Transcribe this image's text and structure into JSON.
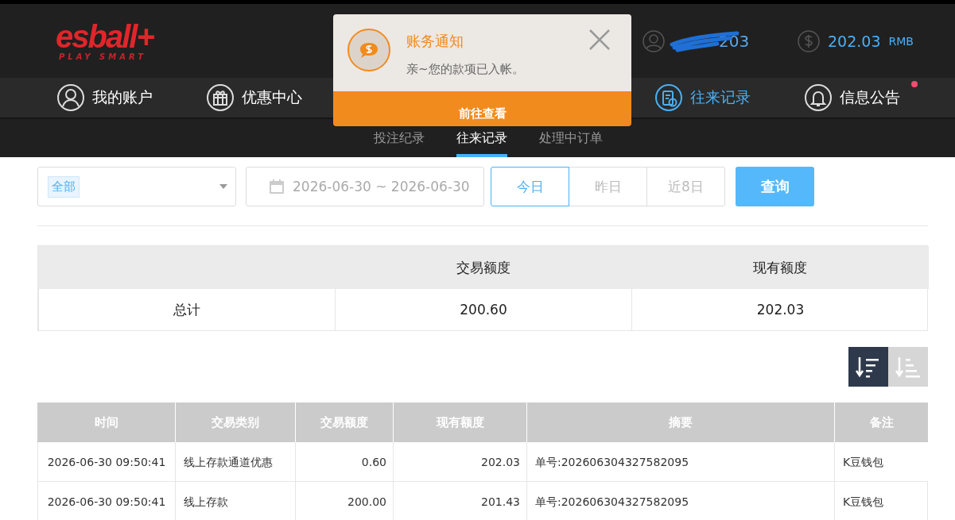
{
  "header": {
    "logo": {
      "name": "esball+",
      "tagline": "PLAY SMART"
    },
    "username": "203",
    "balance": "202.03",
    "currency": "RMB"
  },
  "nav": [
    {
      "label": "我的账户",
      "selected": false,
      "badge": false
    },
    {
      "label": "优惠中心",
      "selected": false,
      "badge": false
    },
    {
      "label": "往来记录",
      "selected": true,
      "badge": false
    },
    {
      "label": "信息公告",
      "selected": false,
      "badge": true
    }
  ],
  "subtabs": [
    {
      "label": "投注纪录",
      "selected": false
    },
    {
      "label": "往来记录",
      "selected": true
    },
    {
      "label": "处理中订单",
      "selected": false
    }
  ],
  "notification": {
    "title": "账务通知",
    "message": "亲~您的款项已入帐。",
    "action": "前往查看"
  },
  "filters": {
    "type_tag": "全部",
    "date_range": "2026-06-30 ~ 2026-06-30",
    "ranges": [
      {
        "label": "今日",
        "selected": true
      },
      {
        "label": "昨日",
        "selected": false
      },
      {
        "label": "近8日",
        "selected": false
      }
    ],
    "query": "查询"
  },
  "summary": {
    "columns": [
      "交易额度",
      "现有额度"
    ],
    "label": "总计",
    "values": [
      "200.60",
      "202.03"
    ]
  },
  "sort": [
    {
      "kind": "descending",
      "selected": true
    },
    {
      "kind": "ascending",
      "selected": false
    }
  ],
  "table": {
    "columns": [
      "时间",
      "交易类别",
      "交易额度",
      "现有额度",
      "摘要",
      "备注"
    ],
    "rows": [
      [
        "2026-06-30 09:50:41",
        "线上存款通道优惠",
        "0.60",
        "202.03",
        "单号:202606304327582095",
        "K豆钱包"
      ],
      [
        "2026-06-30 09:50:41",
        "线上存款",
        "200.00",
        "201.43",
        "单号:202606304327582095",
        "K豆钱包"
      ]
    ]
  }
}
